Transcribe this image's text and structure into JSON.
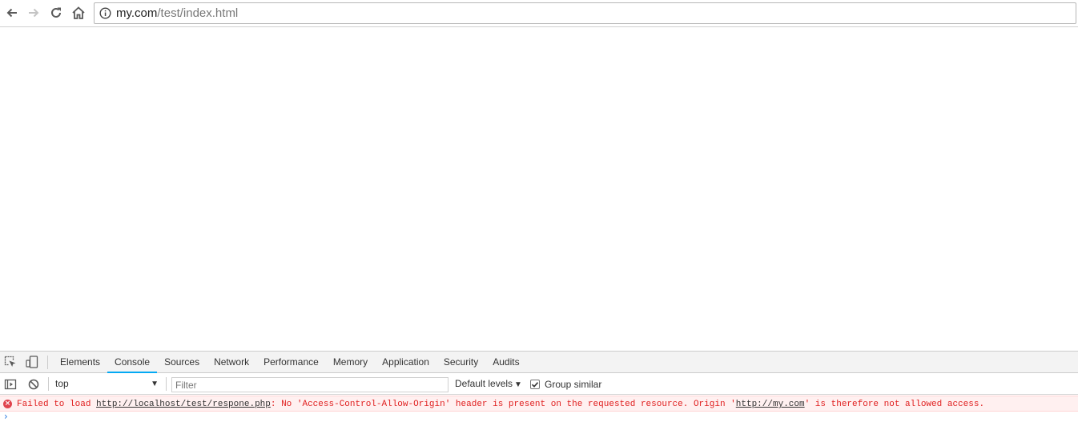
{
  "browser": {
    "url_host": "my.com",
    "url_path": "/test/index.html"
  },
  "icons": {
    "back": "back-arrow-icon",
    "forward": "forward-arrow-icon",
    "reload": "reload-icon",
    "home": "home-icon",
    "info": "info-icon",
    "inspect": "inspect-element-icon",
    "device": "device-toolbar-icon",
    "sidebar": "console-sidebar-icon",
    "clear": "clear-console-icon",
    "error": "error-icon",
    "prompt": "chevron-right-icon"
  },
  "devtools": {
    "tabs": [
      "Elements",
      "Console",
      "Sources",
      "Network",
      "Performance",
      "Memory",
      "Application",
      "Security",
      "Audits"
    ],
    "active_tab": "Console",
    "context": "top",
    "filter_placeholder": "Filter",
    "levels_label": "Default levels",
    "group_similar_label": "Group similar",
    "group_similar_checked": true
  },
  "console": {
    "error": {
      "part1": "Failed to load ",
      "link1": "http://localhost/test/respone.php",
      "part2": ": No 'Access-Control-Allow-Origin' header is present on the requested resource. Origin '",
      "link2": "http://my.com",
      "part3": "' is therefore not allowed access."
    },
    "prompt": "›"
  },
  "colors": {
    "error_text": "#e02020",
    "error_bg": "#fff0f0",
    "active_tab_underline": "#03a9f4",
    "prompt": "#2f7de1"
  }
}
